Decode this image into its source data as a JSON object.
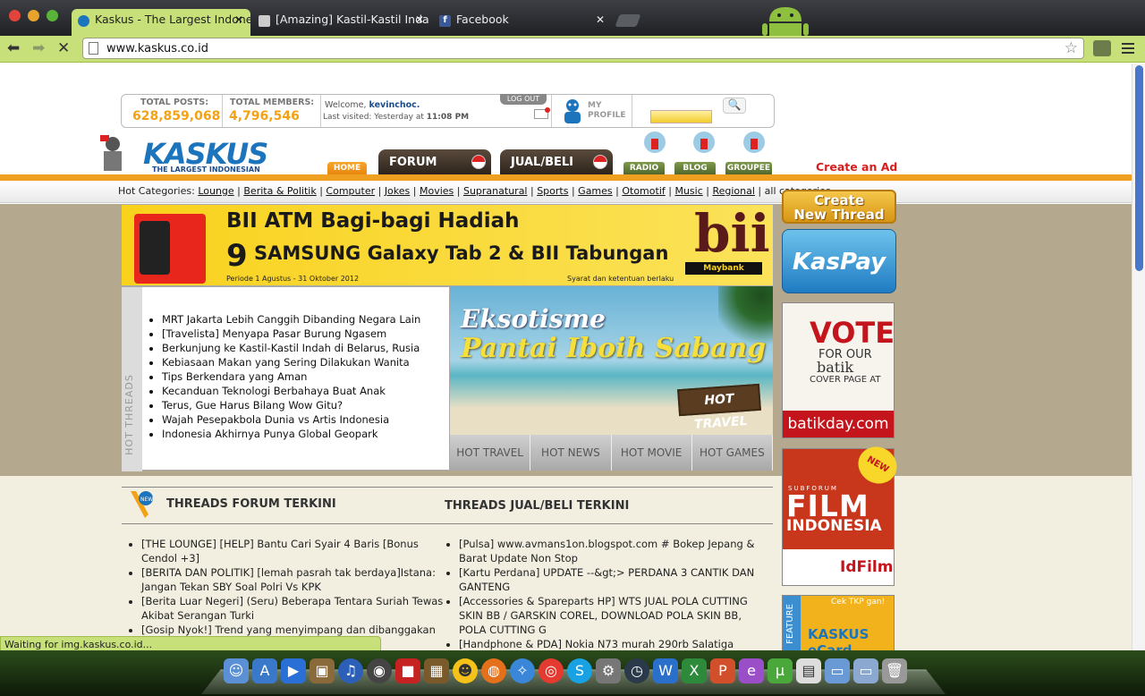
{
  "browser": {
    "tabs": [
      {
        "label": "Kaskus - The Largest Indone",
        "active": true
      },
      {
        "label": "[Amazing] Kastil-Kastil Inda",
        "active": false
      },
      {
        "label": "Facebook",
        "active": false
      }
    ],
    "url": "www.kaskus.co.id",
    "status": "Waiting for img.kaskus.co.id..."
  },
  "stats": {
    "posts_label": "TOTAL POSTS:",
    "posts_value": "628,859,068",
    "members_label": "TOTAL MEMBERS:",
    "members_value": "4,796,546"
  },
  "user": {
    "welcome": "Welcome,",
    "name": "kevinchoc.",
    "last_visit_label": "Last visited: Yesterday at",
    "last_visit_time": "11:08 PM",
    "logout": "LOG OUT",
    "my_profile_1": "MY",
    "my_profile_2": "PROFILE"
  },
  "logo": {
    "name": "KASKUS",
    "tagline": "THE LARGEST INDONESIAN COMMUNITY"
  },
  "nav": {
    "home": "HOME",
    "forum": "FORUM",
    "jualbeli": "JUAL/BELI",
    "radio": "RADIO",
    "blog": "BLOG",
    "groupee": "GROUPEE",
    "create_ad": "Create an Ad"
  },
  "hot_categories": {
    "label": "Hot Categories:",
    "items": [
      "Lounge",
      "Berita & Politik",
      "Computer",
      "Jokes",
      "Movies",
      "Supranatural",
      "Sports",
      "Games",
      "Otomotif",
      "Music",
      "Regional"
    ],
    "all": "all categories"
  },
  "banner": {
    "line1": "BII ATM Bagi-bagi Hadiah",
    "number": "9",
    "line2": "SAMSUNG Galaxy Tab 2 & BII Tabungan",
    "period": "Periode 1 Agustus - 31 Oktober 2012",
    "terms": "Syarat dan ketentuan berlaku",
    "brand": "bii",
    "brand_sub": "Maybank"
  },
  "hot_threads": {
    "label": "HOT THREADS",
    "items": [
      "MRT Jakarta Lebih Canggih Dibanding Negara Lain",
      "[Travelista] Menyapa Pasar Burung Ngasem",
      "Berkunjung ke Kastil-Kastil Indah di Belarus, Rusia",
      "Kebiasaan Makan yang Sering Dilakukan Wanita",
      "Tips Berkendara yang Aman",
      "Kecanduan Teknologi Berbahaya Buat Anak",
      "Terus, Gue Harus Bilang Wow Gitu?",
      "Wajah Pesepakbola Dunia vs Artis Indonesia",
      "Indonesia Akhirnya Punya Global Geopark"
    ]
  },
  "hot_image": {
    "title1": "Eksotisme",
    "title2": "Pantai Iboih Sabang",
    "sign": "HOT TRAVEL",
    "tabs": [
      "HOT TRAVEL",
      "HOT NEWS",
      "HOT MOVIE",
      "HOT GAMES"
    ]
  },
  "sidebar": {
    "create_thread_1": "Create",
    "create_thread_2": "New Thread",
    "kaspay": "KasPay",
    "vote": "VOTE",
    "for_our": "FOR OUR",
    "batik": "batik",
    "cover": "COVER PAGE AT",
    "batikday": "batikday.com",
    "film_sub": "SUBFORUM",
    "film": "FILM",
    "indonesia": "INDONESIA",
    "new_badge": "NEW",
    "idfilm": "IdFilm",
    "feature": "FEATURE",
    "ecard": "KASKUS eCard",
    "cek": "Cek TKP gan!"
  },
  "forum_threads": {
    "title": "THREADS FORUM TERKINI",
    "items": [
      "[THE LOUNGE] [HELP] Bantu Cari Syair 4 Baris [Bonus Cendol +3]",
      "[BERITA DAN POLITIK] [lemah pasrah tak berdaya]Istana: Jangan Tekan SBY Soal Polri Vs KPK",
      "[Berita Luar Negeri] (Seru) Beberapa Tentara Suriah Tewas Akibat Serangan Turki",
      "[Gosip Nyok!] Trend yang menyimpang dan dibanggakan"
    ]
  },
  "jualbeli_threads": {
    "title": "THREADS JUAL/BELI TERKINI",
    "items": [
      "[Pulsa] www.avmans1on.blogspot.com # Bokep Jepang & Barat Update Non Stop",
      "[Kartu Perdana] UPDATE --&gt;> PERDANA 3 CANTIK DAN GANTENG",
      "[Accessories & Spareparts HP] WTS JUAL POLA CUTTING SKIN BB / GARSKIN COREL, DOWNLOAD POLA SKIN BB, POLA CUTTING G",
      "[Handphone & PDA] Nokia N73 murah 290rb Salatiga"
    ]
  }
}
